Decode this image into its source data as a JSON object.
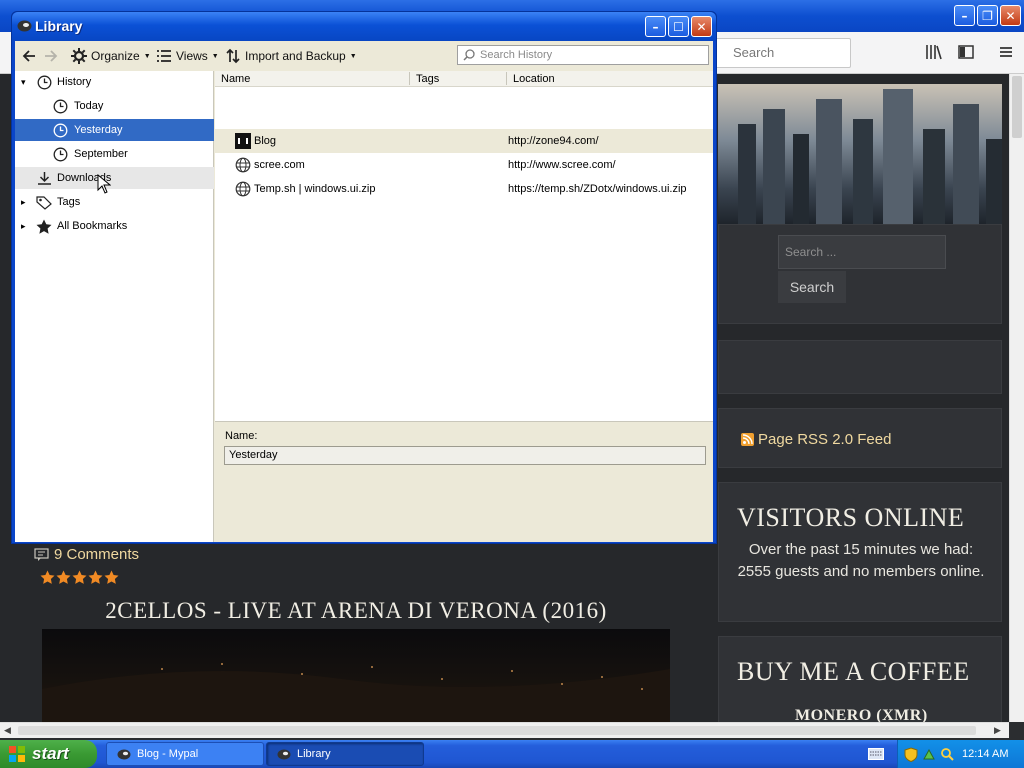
{
  "browser": {
    "search_placeholder": "Search",
    "site": {
      "sidebar_search_placeholder": "Search ...",
      "sidebar_search_button": "Search",
      "rss_link": "Page RSS 2.0 Feed",
      "visitors_heading": "VISITORS ONLINE",
      "visitors_text": "Over the past 15 minutes we had: 2555 guests and no members online.",
      "coffee_heading": "BUY ME A COFFEE",
      "coffee_subheading": "MONERO (XMR)",
      "comments_link": "9 Comments",
      "rating_stars": 5,
      "post_title": "2CELLOS - LIVE AT ARENA DI VERONA (2016)"
    }
  },
  "library": {
    "title": "Library",
    "toolbar": {
      "organize": "Organize",
      "views": "Views",
      "import_backup": "Import and Backup",
      "search_placeholder": "Search History"
    },
    "tree": [
      {
        "label": "History",
        "icon": "clock-icon",
        "expanded": true
      },
      {
        "label": "Today",
        "icon": "clock-icon"
      },
      {
        "label": "Yesterday",
        "icon": "clock-icon",
        "selected": true
      },
      {
        "label": "September",
        "icon": "clock-icon"
      },
      {
        "label": "Downloads",
        "icon": "download-icon"
      },
      {
        "label": "Tags",
        "icon": "tag-icon"
      },
      {
        "label": "All Bookmarks",
        "icon": "star-icon"
      }
    ],
    "columns": {
      "name": "Name",
      "tags": "Tags",
      "location": "Location"
    },
    "rows": [
      {
        "name": "Blog",
        "tags": "",
        "location": "http://zone94.com/",
        "icon": "blog-favicon-icon"
      },
      {
        "name": "scree.com",
        "tags": "",
        "location": "http://www.scree.com/",
        "icon": "globe-icon"
      },
      {
        "name": "Temp.sh | windows.ui.zip",
        "tags": "",
        "location": "https://temp.sh/ZDotx/windows.ui.zip",
        "icon": "globe-icon"
      }
    ],
    "details": {
      "name_label": "Name:",
      "name_value": "Yesterday"
    }
  },
  "taskbar": {
    "start": "start",
    "tasks": [
      {
        "label": "Blog - Mypal"
      },
      {
        "label": "Library"
      }
    ],
    "clock": "12:14 AM"
  },
  "colors": {
    "xp_blue": "#0a46c4",
    "selection": "#316ac5",
    "site_background": "#26282b",
    "rss_orange": "#f0a030",
    "star_orange": "#f08a24"
  }
}
